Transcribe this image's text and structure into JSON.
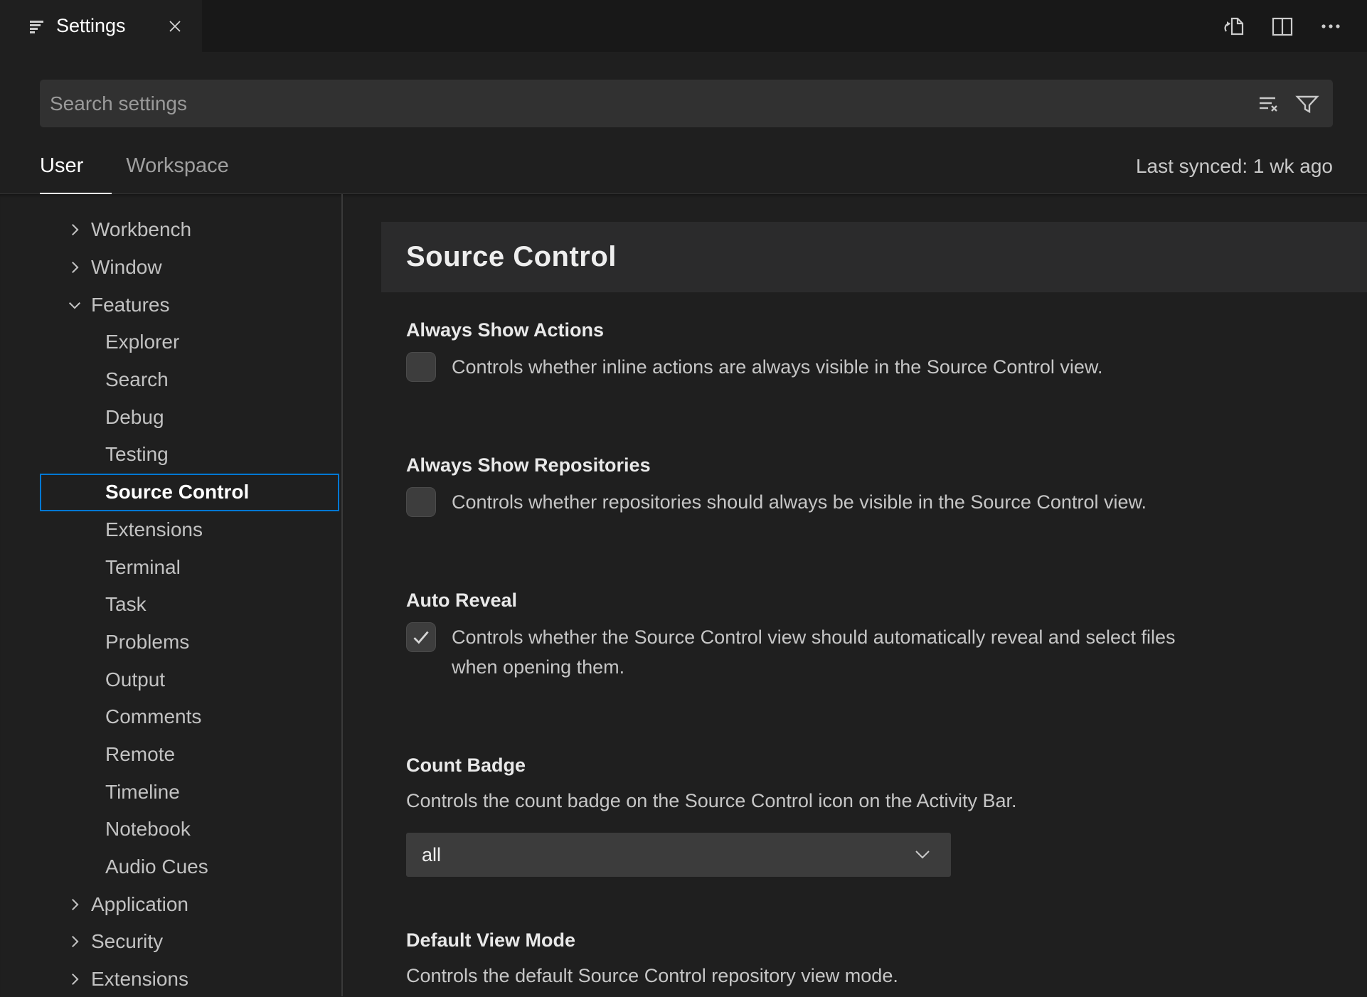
{
  "tab_bar": {
    "tabs": [
      {
        "title": "Settings",
        "active": true
      }
    ],
    "action_icons": [
      "open-settings-json-icon",
      "split-editor-icon",
      "more-actions-icon"
    ]
  },
  "search": {
    "placeholder": "Search settings",
    "icons": [
      "clear-search-results-icon",
      "filter-icon"
    ]
  },
  "scope_bar": {
    "tabs": [
      {
        "label": "User",
        "active": true
      },
      {
        "label": "Workspace",
        "active": false
      }
    ],
    "last_synced": "Last synced: 1 wk ago"
  },
  "toc": {
    "items": [
      {
        "label": "Workbench",
        "level": 1,
        "state": "collapsed"
      },
      {
        "label": "Window",
        "level": 1,
        "state": "collapsed"
      },
      {
        "label": "Features",
        "level": 1,
        "state": "expanded"
      },
      {
        "label": "Explorer",
        "level": 2
      },
      {
        "label": "Search",
        "level": 2
      },
      {
        "label": "Debug",
        "level": 2
      },
      {
        "label": "Testing",
        "level": 2
      },
      {
        "label": "Source Control",
        "level": 2,
        "selected": true
      },
      {
        "label": "Extensions",
        "level": 2
      },
      {
        "label": "Terminal",
        "level": 2
      },
      {
        "label": "Task",
        "level": 2
      },
      {
        "label": "Problems",
        "level": 2
      },
      {
        "label": "Output",
        "level": 2
      },
      {
        "label": "Comments",
        "level": 2
      },
      {
        "label": "Remote",
        "level": 2
      },
      {
        "label": "Timeline",
        "level": 2
      },
      {
        "label": "Notebook",
        "level": 2
      },
      {
        "label": "Audio Cues",
        "level": 2
      },
      {
        "label": "Application",
        "level": 1,
        "state": "collapsed"
      },
      {
        "label": "Security",
        "level": 1,
        "state": "collapsed"
      },
      {
        "label": "Extensions",
        "level": 1,
        "state": "collapsed"
      }
    ]
  },
  "main": {
    "title": "Source Control",
    "settings": [
      {
        "label": "Always Show Actions",
        "type": "checkbox",
        "checked": false,
        "description": "Controls whether inline actions are always visible in the Source Control view."
      },
      {
        "label": "Always Show Repositories",
        "type": "checkbox",
        "checked": false,
        "description": "Controls whether repositories should always be visible in the Source Control view."
      },
      {
        "label": "Auto Reveal",
        "type": "checkbox",
        "checked": true,
        "description_lines": [
          "Controls whether the Source Control view should automatically reveal and select files",
          "when opening them."
        ]
      },
      {
        "label": "Count Badge",
        "type": "select",
        "value": "all",
        "description": "Controls the count badge on the Source Control icon on the Activity Bar."
      },
      {
        "label": "Default View Mode",
        "type": "select",
        "description": "Controls the default Source Control repository view mode."
      }
    ]
  },
  "colors": {
    "accent": "#0078d4",
    "background": "#1f1f1f",
    "tab_strip": "#181818",
    "header_band": "#2b2b2c",
    "input_background": "#313131",
    "control_background": "#3c3c3c"
  }
}
